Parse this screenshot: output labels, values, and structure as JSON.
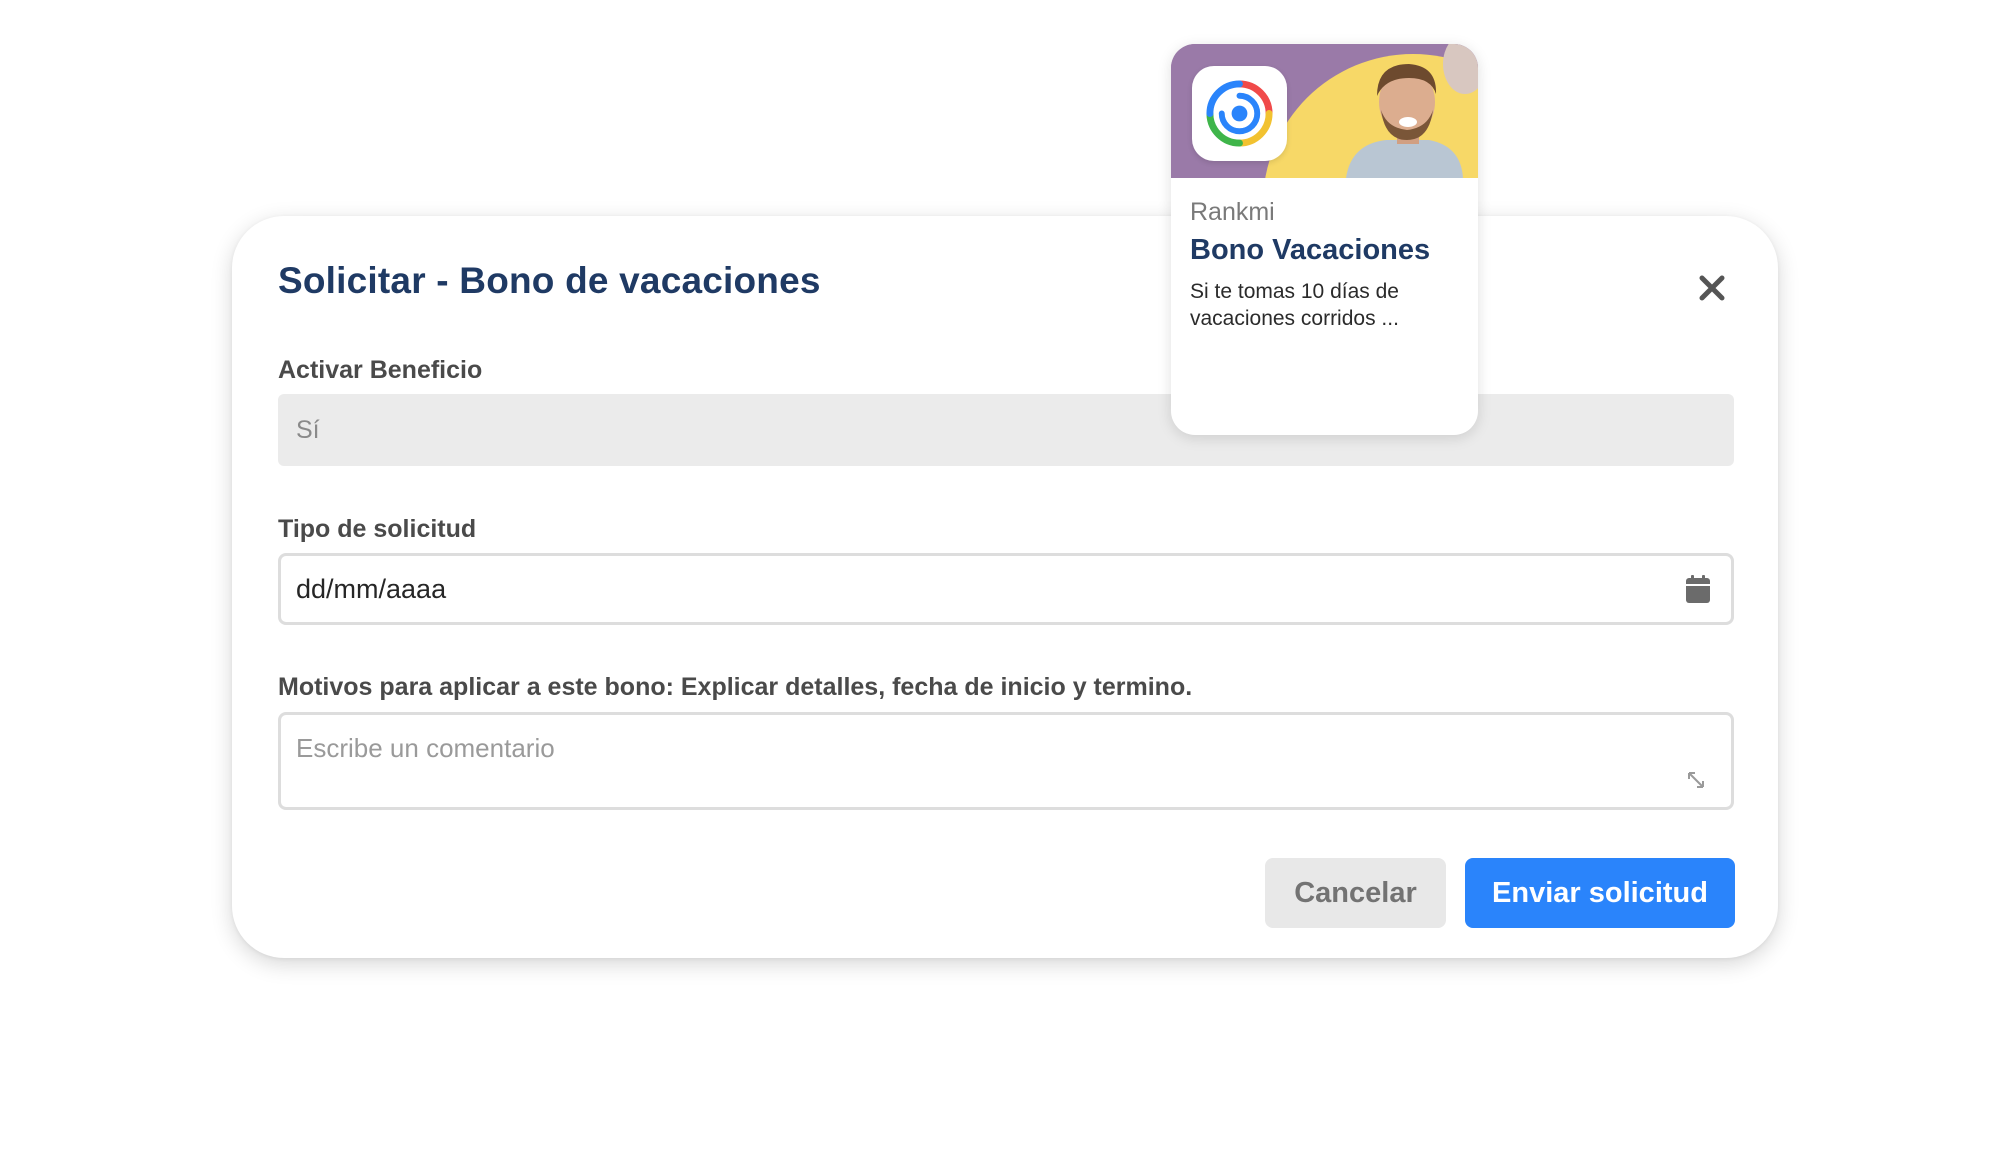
{
  "modal": {
    "title": "Solicitar - Bono de vacaciones",
    "close_icon": "close-icon",
    "fields": {
      "activar": {
        "label": "Activar Beneficio",
        "value": "Sí"
      },
      "tipo": {
        "label": "Tipo de solicitud",
        "placeholder": "dd/mm/aaaa",
        "icon": "calendar-icon"
      },
      "motivos": {
        "label": "Motivos para aplicar a este bono: Explicar detalles, fecha de inicio y termino.",
        "placeholder": "Escribe un comentario",
        "icon": "resize-icon"
      }
    },
    "buttons": {
      "cancel": "Cancelar",
      "send": "Enviar solicitud"
    }
  },
  "card": {
    "brand": "Rankmi",
    "title": "Bono Vacaciones",
    "description": "Si te tomas 10 días de vacaciones corridos ..."
  },
  "colors": {
    "title_navy": "#1f3a64",
    "primary_blue": "#2a84fb",
    "banner_purple": "#9a7aa8",
    "banner_yellow": "#f7d867"
  }
}
